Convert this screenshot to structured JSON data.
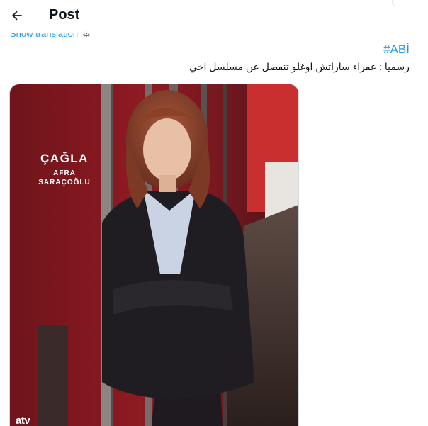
{
  "header": {
    "title": "Post",
    "back_icon": "arrow-left-icon"
  },
  "post": {
    "translation_link": "Show translation",
    "hashtag": "#ABİ",
    "text": "رسميا : عفراء ساراتش اوغلو تنفصل عن مسلسل اخي"
  },
  "media": {
    "character_first_name": "ÇAĞLA",
    "actor_name": "AFRA\nSARAÇOĞLU",
    "channel_logo": "atv"
  },
  "colors": {
    "link": "#1d9bf0",
    "text": "#0f1419",
    "poster_red": "#8e1a22"
  }
}
